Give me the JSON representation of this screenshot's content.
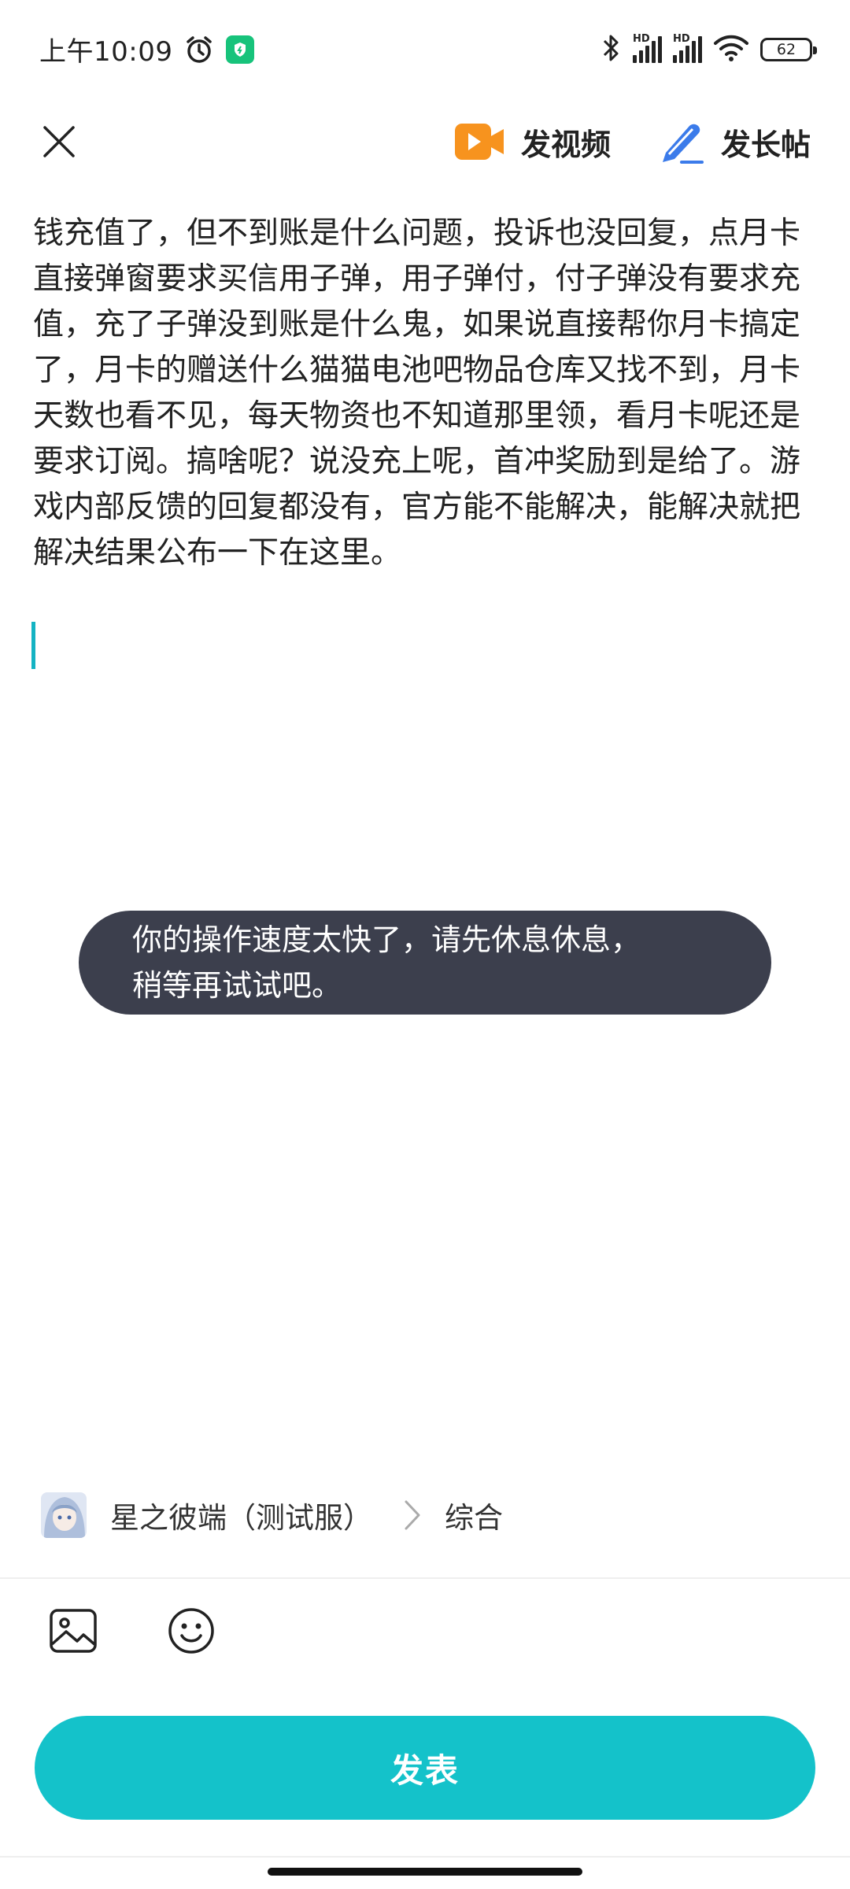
{
  "status_bar": {
    "time": "上午10:09",
    "signal1_label": "HD",
    "signal2_label": "HD",
    "battery": "62"
  },
  "toolbar": {
    "video_label": "发视频",
    "long_post_label": "发长帖"
  },
  "editor": {
    "content": "钱充值了，但不到账是什么问题，投诉也没回复，点月卡直接弹窗要求买信用子弹，用子弹付，付子弹没有要求充值，充了子弹没到账是什么鬼，如果说直接帮你月卡搞定了，月卡的赠送什么猫猫电池吧物品仓库又找不到，月卡天数也看不见，每天物资也不知道那里领，看月卡呢还是要求订阅。搞啥呢？说没充上呢，首冲奖励到是给了。游戏内部反馈的回复都没有，官方能不能解决，能解决就把解决结果公布一下在这里。"
  },
  "toast": {
    "line1": "你的操作速度太快了，请先休息休息，",
    "line2": "稍等再试试吧。"
  },
  "forum": {
    "name": "星之彼端（测试服）",
    "category": "综合"
  },
  "publish": {
    "label": "发表"
  },
  "colors": {
    "accent": "#14c2ca",
    "toast_bg": "#3c3f4d",
    "video_icon": "#f7931e",
    "pen_icon": "#3b7bea",
    "shield_badge": "#17c37b"
  },
  "icons": [
    "alarm-icon",
    "shield-icon",
    "bluetooth-icon",
    "signal-icon",
    "wifi-icon",
    "battery-icon",
    "close-icon",
    "video-camera-icon",
    "pen-icon",
    "chevron-right-icon",
    "image-icon",
    "emoji-icon"
  ]
}
